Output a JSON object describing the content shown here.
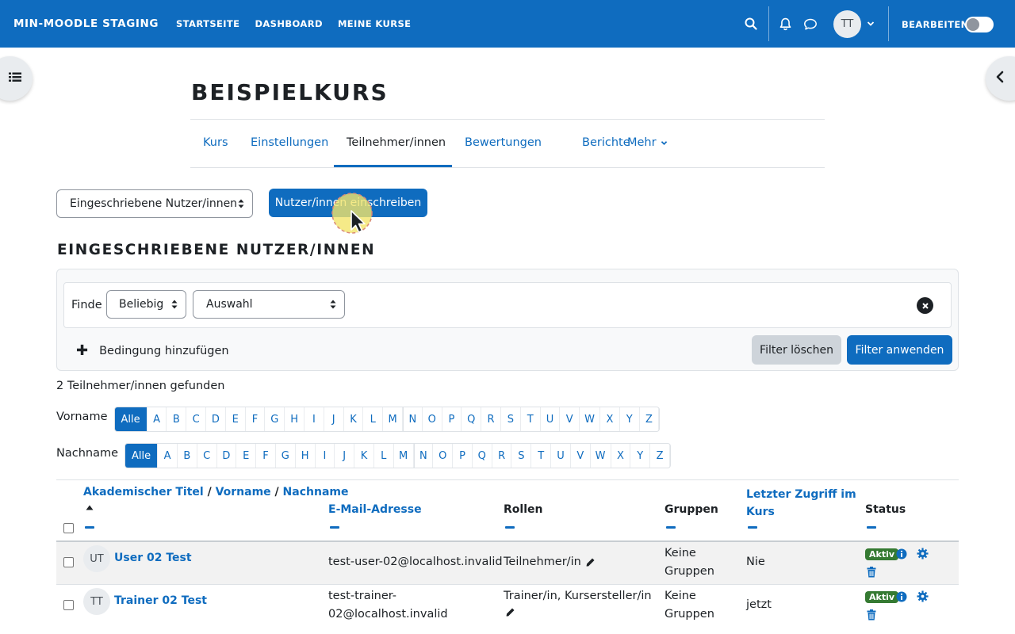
{
  "navbar": {
    "brand": "MIN-MOODLE STAGING",
    "links": [
      "STARTSEITE",
      "DASHBOARD",
      "MEINE KURSE"
    ],
    "avatar_initials": "TT",
    "edit_label": "BEARBEITEN",
    "edit_mode_on": false
  },
  "course": {
    "title": "BEISPIELKURS",
    "tabs": [
      {
        "label": "Kurs",
        "active": false
      },
      {
        "label": "Einstellungen",
        "active": false
      },
      {
        "label": "Teilnehmer/innen",
        "active": true
      },
      {
        "label": "Bewertungen",
        "active": false
      },
      {
        "label": "Berichte",
        "active": false
      },
      {
        "label": "Mehr",
        "active": false
      }
    ]
  },
  "controls": {
    "view_select": "Eingeschriebene Nutzer/innen",
    "enrol_button": "Nutzer/innen einschreiben"
  },
  "section_heading": "EINGESCHRIEBENE NUTZER/INNEN",
  "filter": {
    "finde_label": "Finde",
    "match_select": "Beliebig",
    "type_select": "Auswahl",
    "add_condition": "Bedingung hinzufügen",
    "clear_button": "Filter löschen",
    "apply_button": "Filter anwenden"
  },
  "found_text": "2 Teilnehmer/innen gefunden",
  "initials": {
    "firstname_label": "Vorname",
    "lastname_label": "Nachname",
    "all_label": "Alle",
    "letters": [
      "A",
      "B",
      "C",
      "D",
      "E",
      "F",
      "G",
      "H",
      "I",
      "J",
      "K",
      "L",
      "M",
      "N",
      "O",
      "P",
      "Q",
      "R",
      "S",
      "T",
      "U",
      "V",
      "W",
      "X",
      "Y",
      "Z"
    ]
  },
  "table": {
    "headers": {
      "title": "Akademischer Titel",
      "firstname": "Vorname",
      "lastname": "Nachname",
      "separator": "/",
      "email": "E-Mail-Adresse",
      "roles": "Rollen",
      "groups": "Gruppen",
      "lastaccess_line1": "Letzter Zugriff im",
      "lastaccess_line2": "Kurs",
      "status": "Status"
    },
    "rows": [
      {
        "initials": "UT",
        "name": "User 02 Test",
        "email": "test-user-02@localhost.invalid",
        "roles": "Teilnehmer/in",
        "groups_line1": "Keine",
        "groups_line2": "Gruppen",
        "last_access": "Nie",
        "status": "Aktiv"
      },
      {
        "initials": "TT",
        "name": "Trainer 02 Test",
        "email_line1": "test-trainer-",
        "email_line2": "02@localhost.invalid",
        "roles": "Trainer/in, Kursersteller/in",
        "groups_line1": "Keine",
        "groups_line2": "Gruppen",
        "last_access": "jetzt",
        "status": "Aktiv"
      }
    ]
  },
  "colors": {
    "brand": "#0f6cbf",
    "success": "#357a32",
    "text": "#1d2125"
  }
}
